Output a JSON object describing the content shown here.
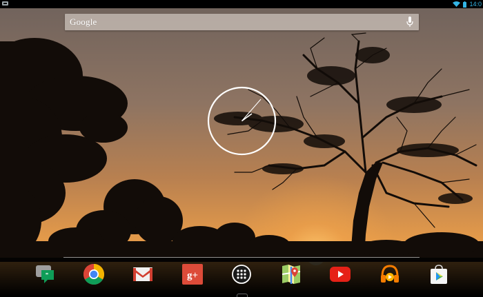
{
  "status_bar": {
    "left_icon": "notification-icon",
    "wifi_icon": "wifi-icon",
    "battery_icon": "battery-icon",
    "time": "14:0"
  },
  "search": {
    "label": "Google",
    "mic_icon": "mic-icon"
  },
  "widget": {
    "type": "analog-clock"
  },
  "dock": {
    "apps": [
      {
        "id": "hangouts",
        "icon": "hangouts-icon"
      },
      {
        "id": "chrome",
        "icon": "chrome-icon"
      },
      {
        "id": "gmail",
        "icon": "gmail-icon"
      },
      {
        "id": "google-plus",
        "icon": "google-plus-icon",
        "glyph": "g+"
      },
      {
        "id": "app-drawer",
        "icon": "app-drawer-icon"
      },
      {
        "id": "maps",
        "icon": "maps-icon"
      },
      {
        "id": "youtube",
        "icon": "youtube-icon"
      },
      {
        "id": "play-music",
        "icon": "play-music-icon"
      },
      {
        "id": "play-store",
        "icon": "play-store-icon"
      }
    ]
  },
  "colors": {
    "sky_top": "#7d6a60",
    "sky_mid": "#b47c4f",
    "horizon": "#f0a349",
    "accent_clock": "#33b5e5",
    "gplus_red": "#dd4b39",
    "youtube_red": "#e62117"
  }
}
